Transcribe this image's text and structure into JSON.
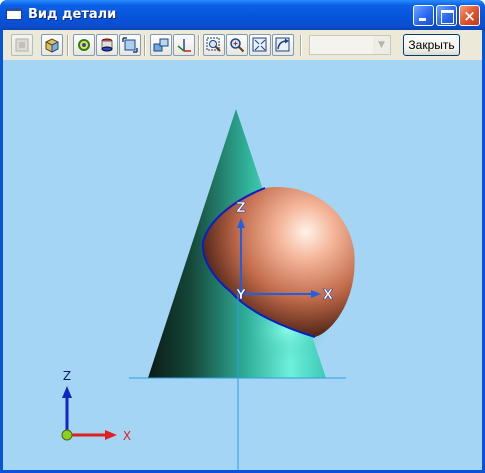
{
  "window": {
    "title": "Вид детали",
    "controls": {
      "minimize": "minimize",
      "maximize": "maximize",
      "close": "×"
    }
  },
  "toolbar": {
    "buttons": [
      {
        "name": "display-mode-button",
        "icon": "display-icon"
      },
      {
        "name": "solid-view-button",
        "icon": "solid-box-icon"
      },
      {
        "name": "rotate-view-button",
        "icon": "rotate-icon"
      },
      {
        "name": "pan-view-button",
        "icon": "pan-icon"
      },
      {
        "name": "fit-view-button",
        "icon": "fit-icon"
      },
      {
        "name": "view-orientation-button",
        "icon": "orientation-icon"
      },
      {
        "name": "axis-view-button",
        "icon": "axis-icon"
      },
      {
        "name": "zoom-window-button",
        "icon": "zoom-window-icon"
      },
      {
        "name": "zoom-in-button",
        "icon": "zoom-icon"
      },
      {
        "name": "zoom-fit-button",
        "icon": "zoom-fit-icon"
      },
      {
        "name": "zoom-previous-button",
        "icon": "zoom-previous-icon"
      }
    ],
    "view_select": {
      "value": ""
    },
    "close_label": "Закрыть"
  },
  "viewport": {
    "background": "#a5d5f4",
    "part_axes": {
      "z": "Z",
      "y": "Y",
      "x": "X"
    },
    "triad_axes": {
      "z": "Z",
      "x": "X"
    },
    "colors": {
      "cone": "#3ed6c0",
      "sphere": "#f0a888",
      "intersection_curve": "#0a1ec8",
      "axis_line": "#2aa0e0",
      "axis_arrow": "#2060e0",
      "triad_x": "#e02020",
      "triad_z": "#1028c0",
      "triad_origin": "#8ad020"
    }
  }
}
